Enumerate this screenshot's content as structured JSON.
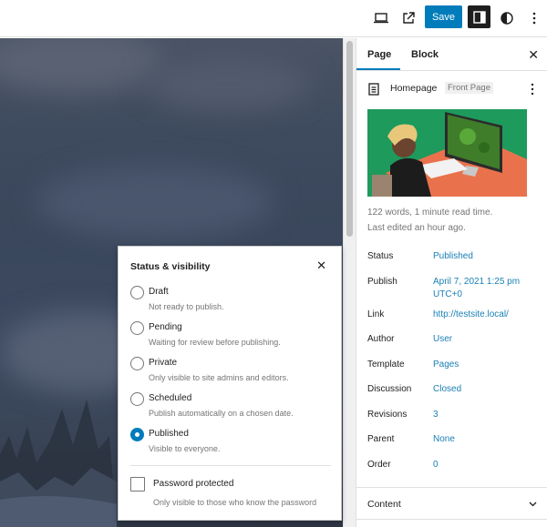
{
  "toolbar": {
    "preview_icon": "laptop-icon",
    "view_icon": "external-link-icon",
    "save_label": "Save",
    "sidebar_icon": "sidebar-toggle-icon",
    "styles_icon": "half-circle-contrast-icon",
    "options_icon": "vertical-ellipsis-icon"
  },
  "sidebar": {
    "tabs": [
      {
        "label": "Page",
        "active": true
      },
      {
        "label": "Block",
        "active": false
      }
    ],
    "close_icon": "close-icon",
    "document": {
      "icon": "page-icon",
      "title": "Homepage",
      "badge": "Front Page",
      "more_icon": "vertical-ellipsis-icon"
    },
    "featured_image_alt": "Illustration of a person at a computer desk playing a game",
    "stats": "122 words, 1 minute read time.",
    "last_edited": "Last edited an hour ago.",
    "fields": [
      {
        "label": "Status",
        "value": "Published"
      },
      {
        "label": "Publish",
        "value": "April 7, 2021 1:25 pm UTC+0"
      },
      {
        "label": "Link",
        "value": "http://testsite.local/"
      },
      {
        "label": "Author",
        "value": "User"
      },
      {
        "label": "Template",
        "value": "Pages"
      },
      {
        "label": "Discussion",
        "value": "Closed"
      },
      {
        "label": "Revisions",
        "value": "3"
      },
      {
        "label": "Parent",
        "value": "None"
      },
      {
        "label": "Order",
        "value": "0"
      }
    ],
    "content_section": {
      "label": "Content",
      "icon": "chevron-down-icon"
    }
  },
  "status_popover": {
    "title": "Status & visibility",
    "close_icon": "close-icon",
    "options": [
      {
        "label": "Draft",
        "help": "Not ready to publish.",
        "selected": false
      },
      {
        "label": "Pending",
        "help": "Waiting for review before publishing.",
        "selected": false
      },
      {
        "label": "Private",
        "help": "Only visible to site admins and editors.",
        "selected": false
      },
      {
        "label": "Scheduled",
        "help": "Publish automatically on a chosen date.",
        "selected": false
      },
      {
        "label": "Published",
        "help": "Visible to everyone.",
        "selected": true
      }
    ],
    "password": {
      "label": "Password protected",
      "help": "Only visible to those who know the password",
      "checked": false
    }
  },
  "colors": {
    "accent": "#007cba",
    "link": "#1a7fb4",
    "dark": "#1e1e1e"
  }
}
